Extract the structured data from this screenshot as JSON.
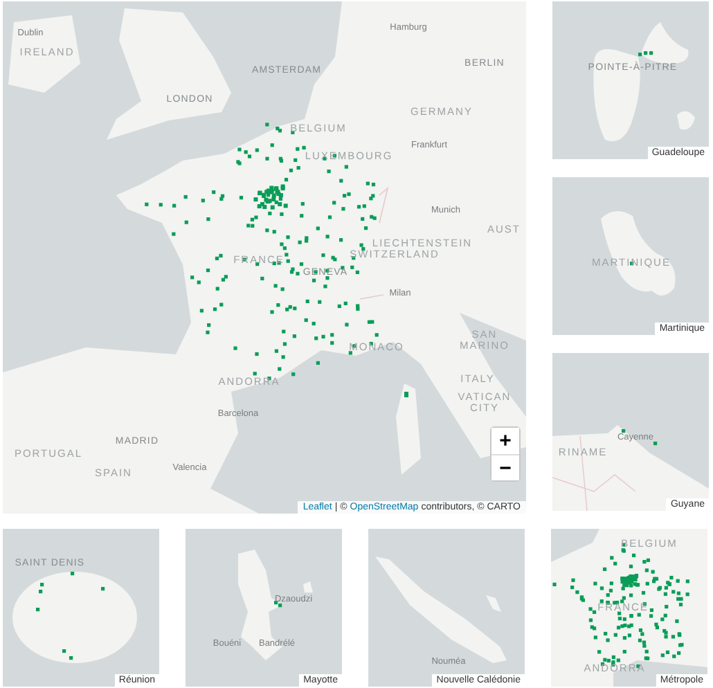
{
  "main_map": {
    "labels": [
      {
        "text": "Dublin",
        "kind": "city"
      },
      {
        "text": "IRELAND",
        "kind": "country"
      },
      {
        "text": "Hamburg",
        "kind": "city"
      },
      {
        "text": "AMSTERDAM",
        "kind": "capital"
      },
      {
        "text": "BERLIN",
        "kind": "capital"
      },
      {
        "text": "LONDON",
        "kind": "capital"
      },
      {
        "text": "GERMANY",
        "kind": "country"
      },
      {
        "text": "BELGIUM",
        "kind": "country"
      },
      {
        "text": "Frankfurt",
        "kind": "city"
      },
      {
        "text": "LUXEMBOURG",
        "kind": "country"
      },
      {
        "text": "Munich",
        "kind": "city"
      },
      {
        "text": "AUST",
        "kind": "country"
      },
      {
        "text": "LIECHTENSTEIN",
        "kind": "country"
      },
      {
        "text": "SWITZERLAND",
        "kind": "country"
      },
      {
        "text": "FRANCE",
        "kind": "country"
      },
      {
        "text": "GENEVA",
        "kind": "capital"
      },
      {
        "text": "Milan",
        "kind": "city"
      },
      {
        "text": "MONACO",
        "kind": "country"
      },
      {
        "text": "SAN MARINO",
        "kind": "country"
      },
      {
        "text": "ITALY",
        "kind": "country"
      },
      {
        "text": "VATICAN CITY",
        "kind": "country"
      },
      {
        "text": "ANDORRA",
        "kind": "country"
      },
      {
        "text": "Barcelona",
        "kind": "city"
      },
      {
        "text": "MADRID",
        "kind": "capital"
      },
      {
        "text": "PORTUGAL",
        "kind": "country"
      },
      {
        "text": "SPAIN",
        "kind": "country"
      },
      {
        "text": "Valencia",
        "kind": "city"
      }
    ],
    "zoom_controls": [
      "+",
      "−"
    ],
    "attribution": [
      {
        "kind": "link",
        "text": "Leaflet"
      },
      {
        "kind": "text",
        "text": "| ©"
      },
      {
        "kind": "link",
        "text": "OpenStreetMap"
      },
      {
        "kind": "text",
        "text": "contributors, © CARTO"
      }
    ]
  },
  "insets": [
    {
      "caption": "Guadeloupe",
      "labels": [
        {
          "text": "POINTE-À-PITRE",
          "kind": "capital"
        }
      ]
    },
    {
      "caption": "Martinique",
      "labels": [
        {
          "text": "MARTINIQUE",
          "kind": "country"
        }
      ]
    },
    {
      "caption": "Guyane",
      "labels": [
        {
          "text": "Cayenne",
          "kind": "city"
        },
        {
          "text": "RINAME",
          "kind": "country"
        }
      ]
    },
    {
      "caption": "Réunion",
      "labels": [
        {
          "text": "SAINT DENIS",
          "kind": "capital"
        }
      ]
    },
    {
      "caption": "Mayotte",
      "labels": [
        {
          "text": "Dzaoudzi",
          "kind": "city"
        },
        {
          "text": "Bouéni",
          "kind": "city"
        },
        {
          "text": "Bandrélé",
          "kind": "city"
        }
      ]
    },
    {
      "caption": "Nouvelle Calédonie",
      "labels": [
        {
          "text": "Nouméa",
          "kind": "city"
        }
      ]
    },
    {
      "caption": "Métropole",
      "labels": [
        {
          "text": "BELGIUM",
          "kind": "country"
        },
        {
          "text": "FRANCE",
          "kind": "country"
        },
        {
          "text": "ANDORRA",
          "kind": "country"
        }
      ]
    }
  ]
}
